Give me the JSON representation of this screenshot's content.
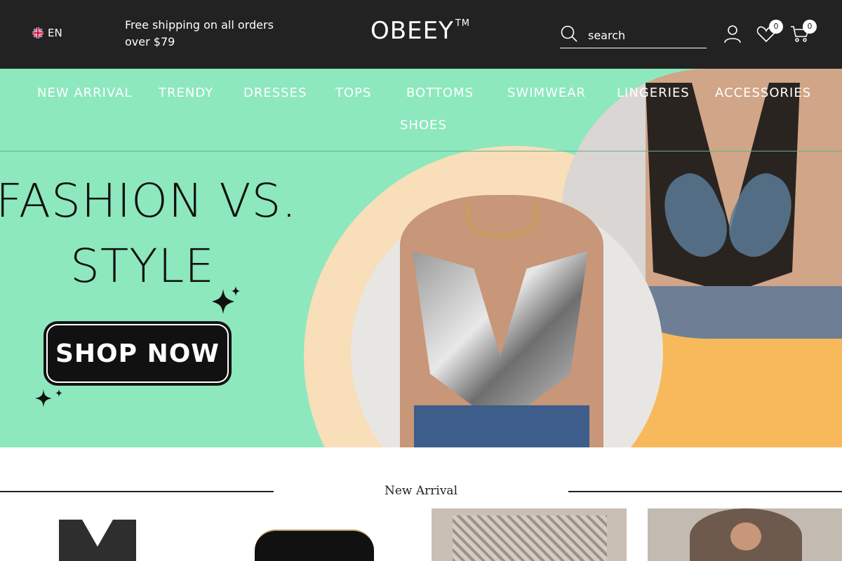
{
  "header": {
    "language": "EN",
    "shipping_notice": "Free shipping on all orders over $79",
    "logo_text": "OBEEY",
    "logo_mark": "TM",
    "search": {
      "placeholder": "search"
    },
    "wishlist_count": "0",
    "cart_count": "0"
  },
  "nav": {
    "items": [
      {
        "label": "NEW ARRIVAL"
      },
      {
        "label": "TRENDY"
      },
      {
        "label": "DRESSES"
      },
      {
        "label": "TOPS"
      },
      {
        "label": "BOTTOMS"
      },
      {
        "label": "SWIMWEAR"
      },
      {
        "label": "LINGERIES"
      },
      {
        "label": "ACCESSORIES"
      },
      {
        "label": "SHOES"
      }
    ]
  },
  "hero": {
    "headline_line1": "FASHION VS.",
    "headline_line2": "STYLE",
    "cta_label": "SHOP NOW",
    "colors": {
      "background": "#8de8bd",
      "peach": "#f8deb9",
      "orange": "#f7b95b"
    }
  },
  "section": {
    "title": "New Arrival"
  },
  "colors": {
    "topbar": "#222222",
    "text_light": "#ffffff"
  }
}
